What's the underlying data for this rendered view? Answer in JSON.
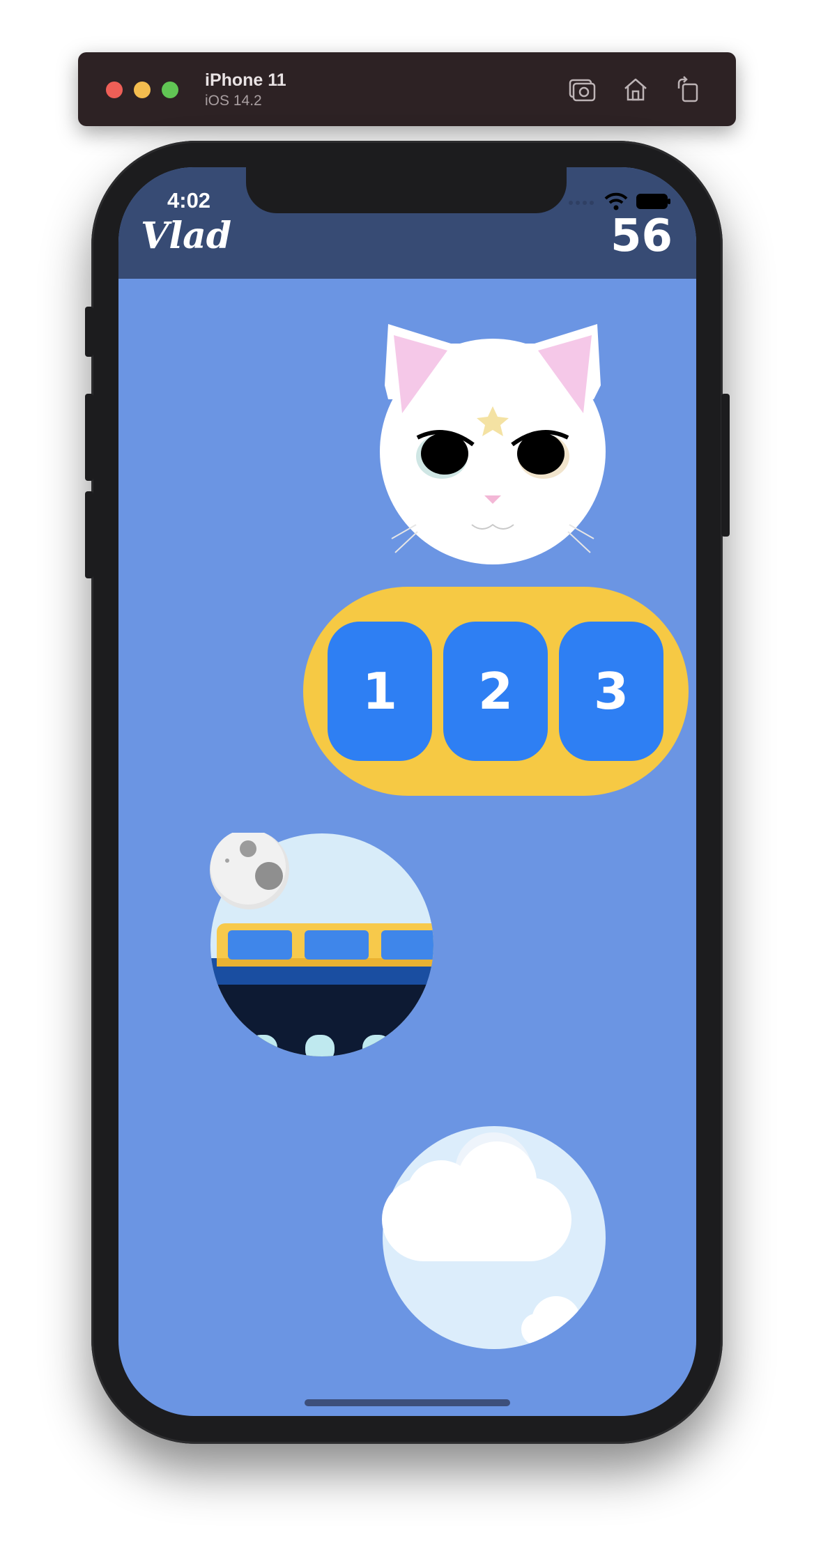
{
  "simulator": {
    "device_name": "iPhone 11",
    "os_version": "iOS 14.2",
    "buttons": [
      "screenshot-icon",
      "home-icon",
      "rotate-icon"
    ]
  },
  "status_bar": {
    "time": "4:02"
  },
  "header": {
    "user_name": "Vlad",
    "score": "56"
  },
  "cards": {
    "digits": [
      "1",
      "2",
      "3"
    ]
  },
  "colors": {
    "background": "#6b95e3",
    "header": "#374b74",
    "digit_frame": "#f6c944",
    "digit_tile": "#2e7ff3"
  }
}
